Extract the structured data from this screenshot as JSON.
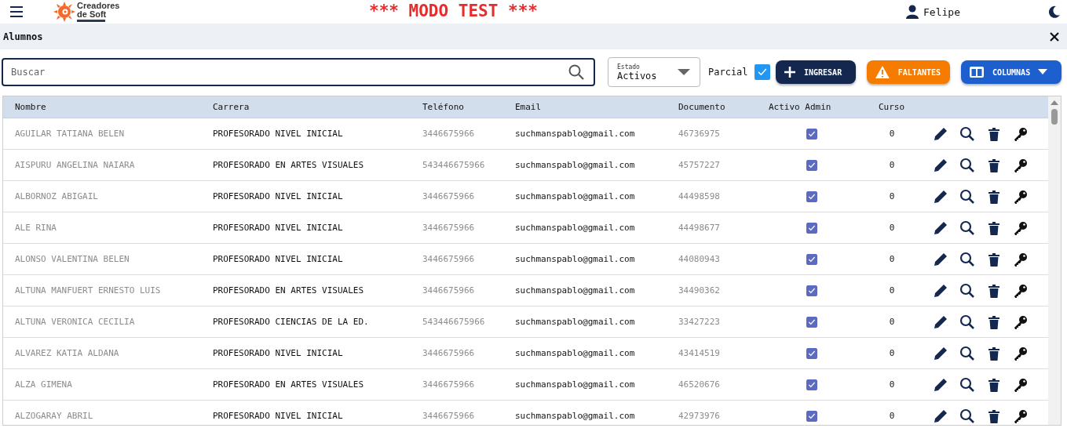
{
  "topbar": {
    "brand_line1": "Creadores",
    "brand_line2": "de Soft",
    "banner": "*** MODO TEST ***",
    "user": "Felipe"
  },
  "page": {
    "title": "Alumnos"
  },
  "toolbar": {
    "search": {
      "placeholder": "Buscar"
    },
    "estado": {
      "label": "Estado",
      "value": "Activos"
    },
    "parcial": {
      "label": "Parcial",
      "checked": true
    },
    "buttons": [
      {
        "kind": "add",
        "label": "INGRESAR"
      },
      {
        "kind": "warning",
        "label": "FALTANTES"
      },
      {
        "kind": "columns",
        "label": "COLUMNAS"
      }
    ]
  },
  "table": {
    "columns": [
      "Nombre",
      "Carrera",
      "Teléfono",
      "Email",
      "Documento",
      "Activo Admin",
      "Curso"
    ],
    "rows": [
      {
        "cells": [
          {
            "text": "AGUILAR TATIANA BELEN",
            "faded": true
          },
          {
            "text": "PROFESORADO NIVEL INICIAL",
            "faded": false
          },
          {
            "text": "3446675966",
            "faded": true
          },
          {
            "text": "suchmanspablo@gmail.com",
            "faded": false
          },
          {
            "text": "46736975",
            "faded": true
          }
        ],
        "activo_admin": true,
        "curso": "0"
      },
      {
        "cells": [
          {
            "text": "AISPURU ANGELINA NAIARA",
            "faded": true
          },
          {
            "text": "PROFESORADO EN ARTES VISUALES",
            "faded": false
          },
          {
            "text": "543446675966",
            "faded": true
          },
          {
            "text": "suchmanspablo@gmail.com",
            "faded": false
          },
          {
            "text": "45757227",
            "faded": true
          }
        ],
        "activo_admin": true,
        "curso": "0"
      },
      {
        "cells": [
          {
            "text": "ALBORNOZ ABIGAIL",
            "faded": true
          },
          {
            "text": "PROFESORADO NIVEL INICIAL",
            "faded": false
          },
          {
            "text": "3446675966",
            "faded": true
          },
          {
            "text": "suchmanspablo@gmail.com",
            "faded": false
          },
          {
            "text": "44498598",
            "faded": true
          }
        ],
        "activo_admin": true,
        "curso": "0"
      },
      {
        "cells": [
          {
            "text": "ALE RINA",
            "faded": true
          },
          {
            "text": "PROFESORADO NIVEL INICIAL",
            "faded": false
          },
          {
            "text": "3446675966",
            "faded": true
          },
          {
            "text": "suchmanspablo@gmail.com",
            "faded": false
          },
          {
            "text": "44498677",
            "faded": true
          }
        ],
        "activo_admin": true,
        "curso": "0"
      },
      {
        "cells": [
          {
            "text": "ALONSO VALENTINA BELEN",
            "faded": true
          },
          {
            "text": "PROFESORADO NIVEL INICIAL",
            "faded": false
          },
          {
            "text": "3446675966",
            "faded": true
          },
          {
            "text": "suchmanspablo@gmail.com",
            "faded": false
          },
          {
            "text": "44080943",
            "faded": true
          }
        ],
        "activo_admin": true,
        "curso": "0"
      },
      {
        "cells": [
          {
            "text": "ALTUNA MANFUERT ERNESTO LUIS",
            "faded": true
          },
          {
            "text": "PROFESORADO EN ARTES VISUALES",
            "faded": false
          },
          {
            "text": "3446675966",
            "faded": true
          },
          {
            "text": "suchmanspablo@gmail.com",
            "faded": false
          },
          {
            "text": "34490362",
            "faded": true
          }
        ],
        "activo_admin": true,
        "curso": "0"
      },
      {
        "cells": [
          {
            "text": "ALTUNA VERONICA CECILIA",
            "faded": true
          },
          {
            "text": "PROFESORADO CIENCIAS DE LA ED.",
            "faded": false
          },
          {
            "text": "543446675966",
            "faded": true
          },
          {
            "text": "suchmanspablo@gmail.com",
            "faded": false
          },
          {
            "text": "33427223",
            "faded": true
          }
        ],
        "activo_admin": true,
        "curso": "0"
      },
      {
        "cells": [
          {
            "text": "ALVAREZ KATIA ALDANA",
            "faded": true
          },
          {
            "text": "PROFESORADO NIVEL INICIAL",
            "faded": false
          },
          {
            "text": "3446675966",
            "faded": true
          },
          {
            "text": "suchmanspablo@gmail.com",
            "faded": false
          },
          {
            "text": "43414519",
            "faded": true
          }
        ],
        "activo_admin": true,
        "curso": "0"
      },
      {
        "cells": [
          {
            "text": "ALZA GIMENA",
            "faded": true
          },
          {
            "text": "PROFESORADO EN ARTES VISUALES",
            "faded": false
          },
          {
            "text": "3446675966",
            "faded": true
          },
          {
            "text": "suchmanspablo@gmail.com",
            "faded": false
          },
          {
            "text": "46520676",
            "faded": true
          }
        ],
        "activo_admin": true,
        "curso": "0"
      },
      {
        "cells": [
          {
            "text": "ALZOGARAY ABRIL",
            "faded": true
          },
          {
            "text": "PROFESORADO NIVEL INICIAL",
            "faded": false
          },
          {
            "text": "3446675966",
            "faded": true
          },
          {
            "text": "suchmanspablo@gmail.com",
            "faded": false
          },
          {
            "text": "42973976",
            "faded": true
          }
        ],
        "activo_admin": true,
        "curso": "0"
      }
    ]
  }
}
